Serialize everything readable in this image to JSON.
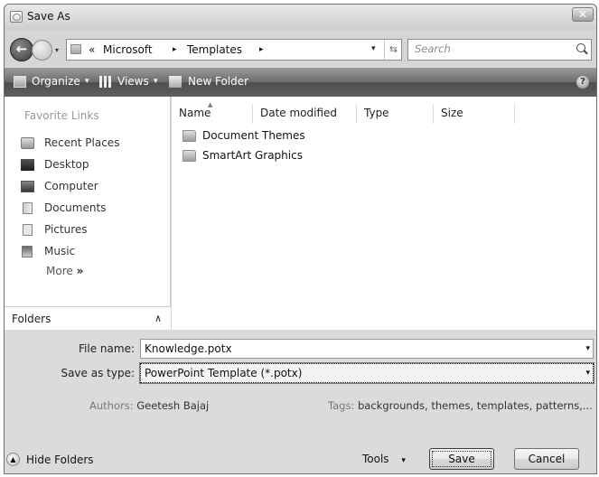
{
  "window": {
    "title": "Save As",
    "close_glyph": "✕"
  },
  "nav": {
    "back_glyph": "←",
    "address": {
      "breadcrumb": [
        "«",
        "Microsoft",
        "▸",
        "Templates",
        "▸"
      ]
    },
    "refresh_glyph": "⇆",
    "search_placeholder": "Search"
  },
  "toolbar": {
    "organize": "Organize",
    "views": "Views",
    "new_folder": "New Folder",
    "dropdown_glyph": "▾",
    "help_glyph": "?"
  },
  "sidebar": {
    "title": "Favorite Links",
    "items": [
      {
        "label": "Recent Places",
        "icon": "recent-places-icon"
      },
      {
        "label": "Desktop",
        "icon": "desktop-icon"
      },
      {
        "label": "Computer",
        "icon": "computer-icon"
      },
      {
        "label": "Documents",
        "icon": "documents-icon"
      },
      {
        "label": "Pictures",
        "icon": "pictures-icon"
      },
      {
        "label": "Music",
        "icon": "music-icon"
      }
    ],
    "more_label": "More",
    "more_glyph": "»",
    "folders_label": "Folders",
    "folders_chevron": "∧"
  },
  "file_list": {
    "columns": [
      "Name",
      "Date modified",
      "Type",
      "Size"
    ],
    "items": [
      {
        "name": "Document Themes",
        "icon": "folder-icon"
      },
      {
        "name": "SmartArt Graphics",
        "icon": "folder-icon"
      }
    ]
  },
  "form": {
    "file_name_label": "File name:",
    "file_name_value": "Knowledge.potx",
    "save_type_label": "Save as type:",
    "save_type_value": "PowerPoint Template (*.potx)",
    "authors_label": "Authors:",
    "authors_value": "Geetesh Bajaj",
    "tags_label": "Tags:",
    "tags_value": "backgrounds, themes, templates, patterns,..."
  },
  "footer": {
    "hide_folders": "Hide Folders",
    "hide_glyph": "▲",
    "tools": "Tools",
    "save": "Save",
    "cancel": "Cancel"
  }
}
